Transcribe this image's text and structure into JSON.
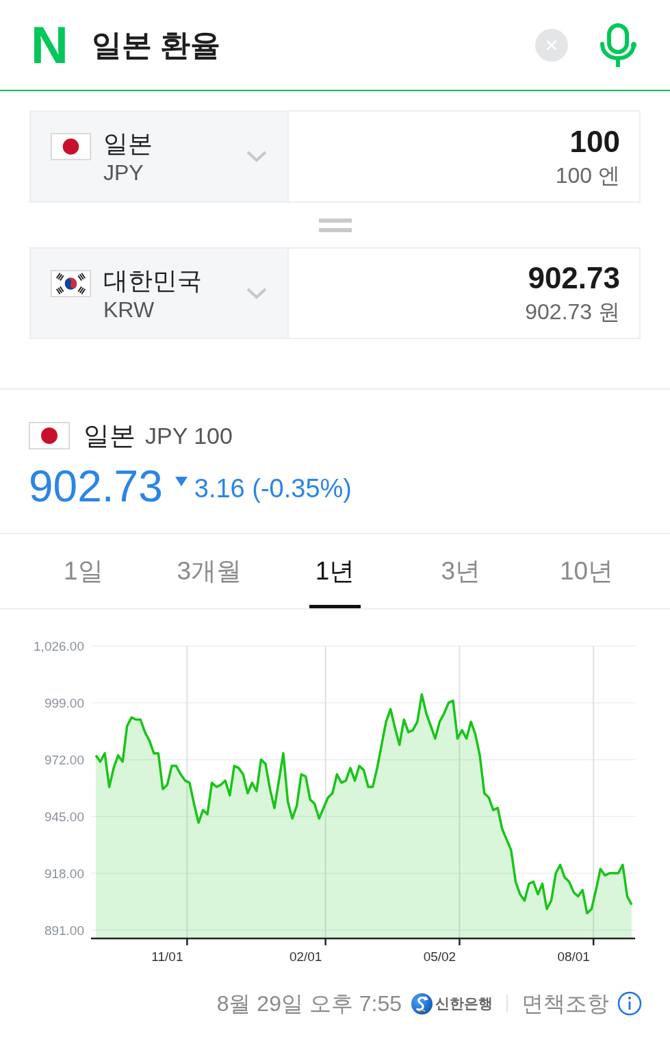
{
  "header": {
    "logo": "N",
    "query": "일본 환율"
  },
  "converter": [
    {
      "kind": "jp",
      "country": "일본",
      "code": "JPY",
      "amount": "100",
      "amount_text": "100 엔"
    },
    {
      "kind": "kr",
      "country": "대한민국",
      "code": "KRW",
      "amount": "902.73",
      "amount_text": "902.73 원"
    }
  ],
  "quote": {
    "kind": "jp",
    "country": "일본",
    "unit": "JPY 100",
    "price": "902.73",
    "down": true,
    "change": "3.16 (-0.35%)"
  },
  "tabs": [
    {
      "label": "1일",
      "selected": false
    },
    {
      "label": "3개월",
      "selected": false
    },
    {
      "label": "1년",
      "selected": true
    },
    {
      "label": "3년",
      "selected": false
    },
    {
      "label": "10년",
      "selected": false
    }
  ],
  "chart": {
    "chart_data": {
      "type": "area",
      "categories": [
        null,
        null,
        null,
        null,
        null,
        null,
        null,
        null,
        null,
        null,
        null,
        null,
        null,
        null,
        null,
        null,
        "11/01",
        null,
        null,
        null,
        null,
        null,
        null,
        null,
        null,
        null,
        null,
        null,
        null,
        null,
        null,
        null,
        null,
        null,
        null,
        null,
        null,
        null,
        null,
        null,
        null,
        null,
        null,
        null,
        null,
        null,
        null,
        "02/01",
        null,
        null,
        null,
        null,
        null,
        null,
        null,
        null,
        null,
        null,
        null,
        null,
        null,
        null,
        null,
        null,
        null,
        null,
        null,
        null,
        null,
        null,
        null,
        null,
        null,
        null,
        null,
        null,
        null,
        "05/02",
        null,
        null,
        null,
        null,
        null,
        null,
        null,
        null,
        null,
        null,
        null,
        null,
        null,
        null,
        null,
        null,
        null,
        null,
        null,
        null,
        null,
        null,
        null,
        null,
        null,
        null,
        null,
        null,
        null,
        "08/01",
        null,
        null,
        null,
        null,
        null,
        null,
        null,
        null,
        null,
        null,
        null,
        null,
        null
      ],
      "series": [
        {
          "color": "#19c419",
          "values": [
            974,
            971,
            975,
            959,
            968,
            974,
            971,
            988,
            992,
            991,
            991,
            985,
            981,
            975,
            975,
            958,
            960,
            969,
            969,
            965,
            962,
            961,
            951,
            942,
            948,
            946,
            961,
            959,
            960,
            962,
            955,
            969,
            968,
            965,
            956,
            961,
            957,
            972,
            970,
            958,
            949,
            962,
            975,
            952,
            944,
            950,
            965,
            964,
            953,
            951,
            944,
            949,
            954,
            956,
            965,
            961,
            962,
            968,
            962,
            969,
            967,
            959,
            959,
            968,
            979,
            990,
            996,
            987,
            979,
            991,
            985,
            986,
            990,
            1003,
            994,
            988,
            982,
            990,
            994,
            999,
            1000,
            982,
            986,
            982,
            990,
            984,
            974,
            956,
            954,
            948,
            949,
            939,
            934,
            929,
            914,
            908,
            905,
            913,
            914,
            908,
            913,
            901,
            905,
            918,
            922,
            916,
            914,
            909,
            907,
            910,
            899,
            901,
            910,
            920,
            917,
            918,
            918,
            918,
            922,
            907,
            903
          ]
        }
      ],
      "ylim": [
        887,
        1026
      ],
      "grid": true,
      "yticks": [
        {
          "value": 1026,
          "label": "1,026.00"
        },
        {
          "value": 999,
          "label": "999.00"
        },
        {
          "value": 972,
          "label": "972.00"
        },
        {
          "value": 945,
          "label": "945.00"
        },
        {
          "value": 918,
          "label": "918.00"
        },
        {
          "value": 891,
          "label": "891.00"
        }
      ]
    }
  },
  "footer": {
    "timestamp": "8월 29일 오후 7:55",
    "bank": "신한은행",
    "disclaimer": "면책조항"
  }
}
